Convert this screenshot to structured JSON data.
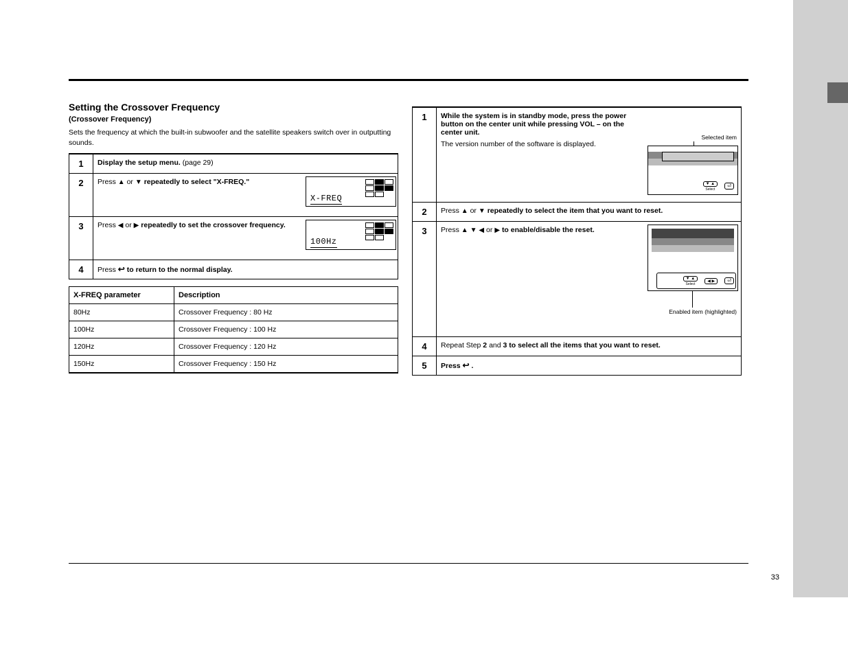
{
  "left": {
    "title": "Setting the Crossover Frequency",
    "subtitle": "(Crossover Frequency)",
    "intro": "Sets the frequency at which the built-in subwoofer and the satellite speakers switch over in outputting sounds.",
    "steps": [
      {
        "n": "1",
        "bold": "Display the setup menu.",
        "plain": " (page 29)",
        "screen": null
      },
      {
        "n": "2",
        "pre": "Press ",
        "tri1": "▲",
        "mid1": " or ",
        "tri2": "▼",
        "post": " repeatedly to select \"X-FREQ.\"",
        "screen": {
          "type": "lcd",
          "text": "X-FREQ"
        }
      },
      {
        "n": "3",
        "pre": "Press ",
        "tri1": "◀",
        "mid1": " or ",
        "tri2": "▶",
        "post": " repeatedly to set the crossover frequency.",
        "screen": {
          "type": "lcd",
          "text": "100Hz"
        }
      },
      {
        "n": "4",
        "pre": "Press ",
        "ret": true,
        "post": " to return to the normal display.",
        "screen": null
      }
    ],
    "params_header": [
      "X-FREQ parameter",
      "Description"
    ],
    "params": [
      [
        "80Hz",
        "Crossover Frequency : 80 Hz"
      ],
      [
        "100Hz",
        "Crossover Frequency : 100 Hz"
      ],
      [
        "120Hz",
        "Crossover Frequency : 120 Hz"
      ],
      [
        "150Hz",
        "Crossover Frequency : 150 Hz"
      ]
    ]
  },
  "right": {
    "steps": [
      {
        "n": "1",
        "text": "While the system is in standby mode, press the power button on the center unit while pressing VOL – on the center unit.",
        "after": "The version number of the software is displayed.",
        "sel_label": "Selected item",
        "tv_btns": [
          "▼ ▲",
          "⏎"
        ],
        "tv_labels": [
          "Select",
          ""
        ]
      },
      {
        "n": "2",
        "pre": "Press ",
        "tri1": "▲",
        "mid1": " or ",
        "tri2": "▼",
        "post": " repeatedly to select the item that you want to reset."
      },
      {
        "n": "3",
        "pre": "Press ",
        "tri1": "▲",
        "tri2": "▼",
        "tri3": "◀",
        "mid": " or ",
        "tri4": "▶",
        "post": " to enable/disable the reset.",
        "en_label": "Enabled item (highlighted)",
        "tv_btns": [
          "▼ ▲",
          "◀ ▶",
          "⏎"
        ],
        "tv_labels": [
          "Select",
          "",
          ""
        ]
      },
      {
        "n": "4",
        "pre": "Repeat Step ",
        "b1": "2",
        "mid1": " and ",
        "b2": "3",
        "post": " to select all the items that you want to reset."
      },
      {
        "n": "5",
        "pre": "Press ",
        "ret": true,
        "post": "."
      }
    ]
  },
  "page_number": "33"
}
